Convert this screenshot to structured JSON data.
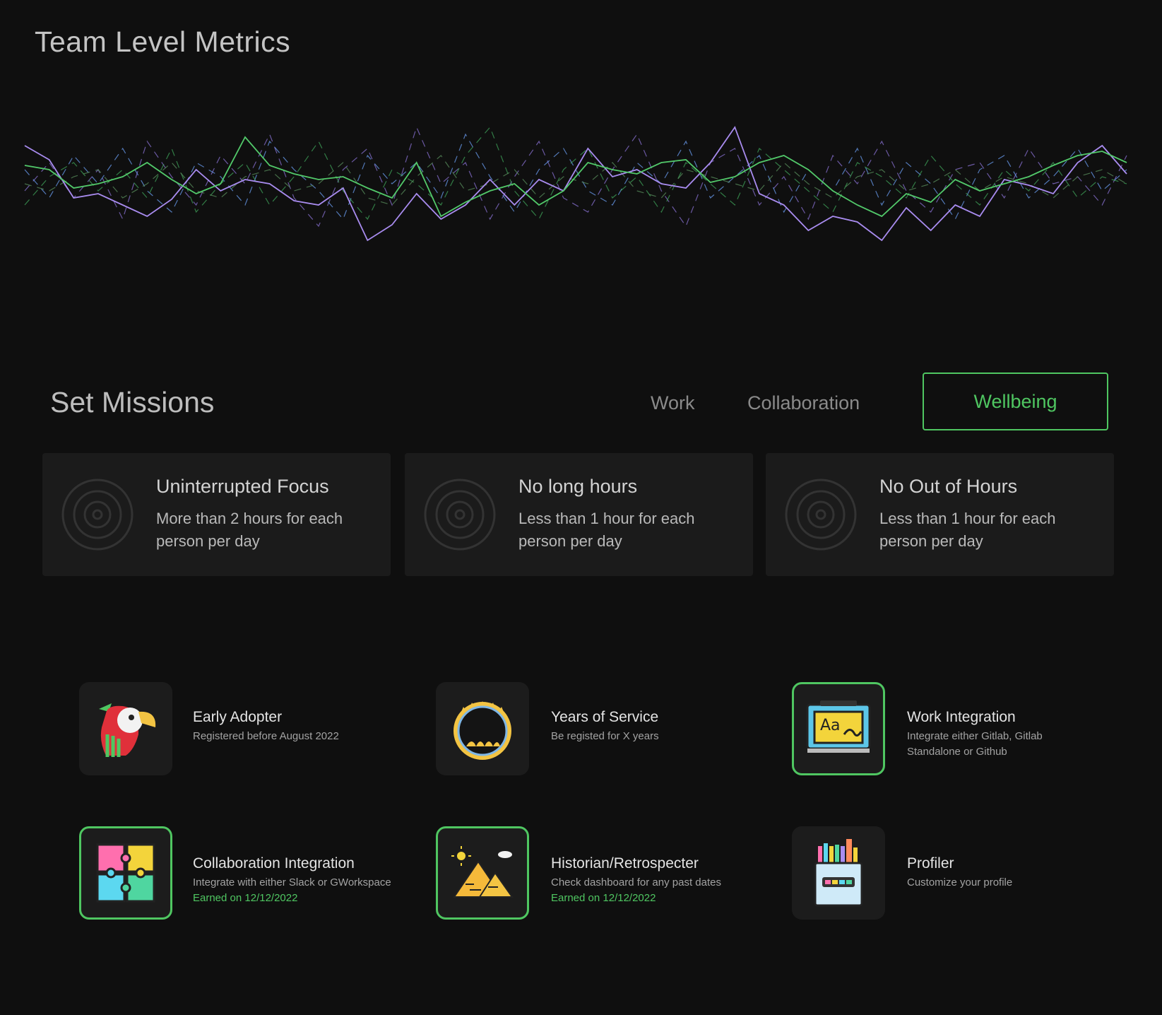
{
  "header": {
    "title": "Team Level Metrics"
  },
  "chart_data": {
    "type": "line",
    "title": "",
    "xlabel": "",
    "ylabel": "",
    "ylim": [
      0,
      100
    ],
    "x": [
      0,
      1,
      2,
      3,
      4,
      5,
      6,
      7,
      8,
      9,
      10,
      11,
      12,
      13,
      14,
      15,
      16,
      17,
      18,
      19,
      20,
      21,
      22,
      23,
      24,
      25,
      26,
      27,
      28,
      29,
      30,
      31,
      32,
      33,
      34,
      35
    ],
    "series": [
      {
        "color": "#a98cf0",
        "dashed": false,
        "values": [
          72,
          62,
          35,
          38,
          30,
          22,
          34,
          55,
          40,
          48,
          45,
          33,
          30,
          42,
          5,
          16,
          38,
          20,
          30,
          48,
          30,
          48,
          40,
          70,
          50,
          55,
          45,
          42,
          60,
          85,
          38,
          30,
          12,
          22,
          18,
          5,
          28,
          12,
          30,
          22,
          48,
          44,
          38,
          60,
          72,
          52
        ]
      },
      {
        "color": "#52c96a",
        "dashed": false,
        "values": [
          58,
          55,
          42,
          45,
          50,
          60,
          48,
          38,
          45,
          78,
          58,
          52,
          48,
          50,
          42,
          35,
          60,
          22,
          32,
          40,
          45,
          30,
          40,
          60,
          55,
          52,
          60,
          62,
          46,
          50,
          60,
          65,
          55,
          40,
          30,
          22,
          38,
          32,
          48,
          40,
          45,
          50,
          58,
          65,
          68,
          60
        ]
      },
      {
        "color": "#8a72d4",
        "dashed": true,
        "values": [
          40,
          60,
          35,
          55,
          20,
          75,
          50,
          30,
          65,
          45,
          80,
          35,
          15,
          55,
          70,
          30,
          85,
          45,
          60,
          20,
          50,
          75,
          35,
          25,
          55,
          80,
          40,
          15,
          60,
          70,
          30,
          50,
          20,
          65,
          45,
          75,
          40,
          25,
          55,
          60,
          35,
          70,
          45,
          50,
          30,
          65
        ]
      },
      {
        "color": "#6a9cf0",
        "dashed": true,
        "values": [
          55,
          35,
          65,
          45,
          70,
          40,
          25,
          60,
          50,
          30,
          75,
          55,
          40,
          20,
          65,
          45,
          60,
          35,
          80,
          50,
          25,
          55,
          70,
          40,
          30,
          60,
          45,
          75,
          35,
          50,
          65,
          25,
          55,
          40,
          70,
          30,
          60,
          45,
          20,
          55,
          65,
          35,
          50,
          70,
          40,
          55
        ]
      },
      {
        "color": "#3fa35a",
        "dashed": true,
        "values": [
          30,
          50,
          60,
          40,
          55,
          35,
          70,
          25,
          45,
          60,
          30,
          50,
          75,
          40,
          20,
          55,
          45,
          30,
          65,
          85,
          40,
          20,
          55,
          70,
          35,
          50,
          25,
          60,
          45,
          30,
          70,
          55,
          40,
          25,
          60,
          50,
          35,
          65,
          45,
          30,
          55,
          40,
          60,
          35,
          50,
          45
        ]
      },
      {
        "color": "#5a8f5e",
        "dashed": true,
        "values": [
          45,
          40,
          50,
          55,
          35,
          45,
          60,
          40,
          35,
          50,
          55,
          40,
          45,
          60,
          35,
          30,
          50,
          65,
          40,
          45,
          55,
          35,
          50,
          45,
          60,
          40,
          35,
          55,
          50,
          45,
          40,
          60,
          45,
          35,
          50,
          55,
          40,
          45,
          55,
          40,
          50,
          45,
          35,
          50,
          55,
          45
        ]
      }
    ]
  },
  "missions": {
    "title": "Set Missions",
    "tabs": [
      {
        "label": "Work"
      },
      {
        "label": "Collaboration"
      },
      {
        "label": "Wellbeing"
      }
    ],
    "cards": [
      {
        "title": "Uninterrupted Focus",
        "desc": "More than 2 hours for each person per day"
      },
      {
        "title": "No long hours",
        "desc": "Less than 1 hour for each person per day"
      },
      {
        "title": "No Out of Hours",
        "desc": "Less than 1 hour for each person per day"
      }
    ]
  },
  "badges": [
    {
      "name": "Early Adopter",
      "desc": "Registered before August 2022",
      "earned": "",
      "icon": "parrot-icon"
    },
    {
      "name": "Years of Service",
      "desc": "Be registed for X years",
      "earned": "",
      "icon": "fire-ring-icon"
    },
    {
      "name": "Work Integration",
      "desc": "Integrate either Gitlab, Gitlab Standalone or Github",
      "earned": "",
      "icon": "whiteboard-icon"
    },
    {
      "name": "Collaboration Integration",
      "desc": "Integrate with either Slack or GWorkspace",
      "earned": "Earned on 12/12/2022",
      "icon": "puzzle-icon"
    },
    {
      "name": "Historian/Retrospecter",
      "desc": "Check dashboard for any past dates",
      "earned": "Earned on 12/12/2022",
      "icon": "pyramids-icon"
    },
    {
      "name": "Profiler",
      "desc": "Customize your profile",
      "earned": "",
      "icon": "crayons-icon"
    }
  ],
  "colors": {
    "accent": "#4fc661",
    "background": "#0f0f0f",
    "card": "#1b1b1b"
  }
}
